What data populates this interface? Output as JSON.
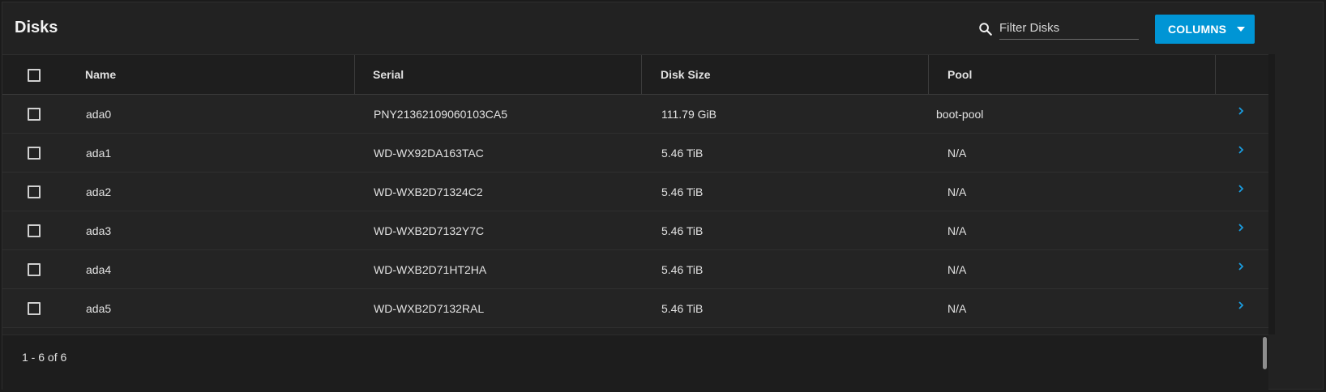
{
  "toolbar": {
    "title": "Disks",
    "search_placeholder": "Filter Disks",
    "search_value": "",
    "columns_label": "COLUMNS"
  },
  "table": {
    "headers": [
      "Name",
      "Serial",
      "Disk Size",
      "Pool"
    ],
    "rows": [
      {
        "name": "ada0",
        "serial": "PNY21362109060103CA5",
        "size": "111.79 GiB",
        "pool": "boot-pool"
      },
      {
        "name": "ada1",
        "serial": "WD-WX92DA163TAC",
        "size": "5.46 TiB",
        "pool": "N/A"
      },
      {
        "name": "ada2",
        "serial": "WD-WXB2D71324C2",
        "size": "5.46 TiB",
        "pool": "N/A"
      },
      {
        "name": "ada3",
        "serial": "WD-WXB2D7132Y7C",
        "size": "5.46 TiB",
        "pool": "N/A"
      },
      {
        "name": "ada4",
        "serial": "WD-WXB2D71HT2HA",
        "size": "5.46 TiB",
        "pool": "N/A"
      },
      {
        "name": "ada5",
        "serial": "WD-WXB2D7132RAL",
        "size": "5.46 TiB",
        "pool": "N/A"
      }
    ]
  },
  "footer": {
    "range_text": "1 - 6 of 6"
  },
  "colors": {
    "accent": "#0095d5",
    "background": "#222222",
    "header_bg": "#1e1e1e"
  }
}
